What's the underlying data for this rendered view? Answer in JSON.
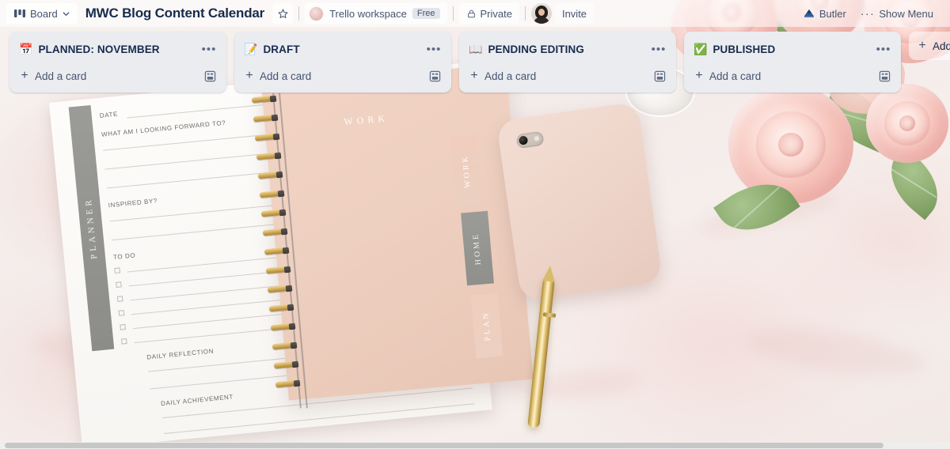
{
  "header": {
    "board_button_label": "Board",
    "board_button_icon": "board-columns-icon",
    "board_button_chevron": "chevron-down-icon",
    "title": "MWC Blog Content Calendar",
    "star_icon": "star-icon",
    "workspace": {
      "name": "Trello workspace",
      "plan_badge": "Free",
      "avatar_icon": "workspace-avatar-icon"
    },
    "visibility": {
      "label": "Private",
      "icon": "lock-icon"
    },
    "member_avatar_icon": "member-avatar",
    "invite_label": "Invite",
    "butler": {
      "label": "Butler",
      "icon": "butler-icon"
    },
    "show_menu": {
      "label": "Show Menu",
      "icon": "ellipsis-icon"
    }
  },
  "lists": [
    {
      "emoji": "📅",
      "emoji_name": "calendar-icon",
      "title": "PLANNED: NOVEMBER",
      "menu_glyph": "•••",
      "add_card_label": "Add a card",
      "add_card_plus": "+",
      "template_icon": "card-template-icon"
    },
    {
      "emoji": "📝",
      "emoji_name": "memo-icon",
      "title": "DRAFT",
      "menu_glyph": "•••",
      "add_card_label": "Add a card",
      "add_card_plus": "+",
      "template_icon": "card-template-icon"
    },
    {
      "emoji": "📖",
      "emoji_name": "open-book-icon",
      "title": "PENDING EDITING",
      "menu_glyph": "•••",
      "add_card_label": "Add a card",
      "add_card_plus": "+",
      "template_icon": "card-template-icon"
    },
    {
      "emoji": "✅",
      "emoji_name": "check-mark-icon",
      "title": "PUBLISHED",
      "menu_glyph": "•••",
      "add_card_label": "Add a card",
      "add_card_plus": "+",
      "template_icon": "card-template-icon"
    }
  ],
  "add_list": {
    "label": "Add another list",
    "plus": "+"
  },
  "background": {
    "description": "Flat-lay photo of a pink spiral planner notebook, pink phone case, gold pen and pink roses on marble",
    "planner_sidebar_text": "PLANNER",
    "notebook_cover_text": "WORK",
    "tabs": [
      "WORK",
      "HOME",
      "PLAN"
    ],
    "paper_labels": [
      "DATE",
      "WHAT AM I LOOKING FORWARD TO?",
      "INSPIRED BY?",
      "TO DO",
      "DAILY REFLECTION",
      "DAILY ACHIEVEMENT"
    ]
  },
  "colors": {
    "list_background": "#ebecf0",
    "text_primary": "#172b4d",
    "text_secondary": "#44546f",
    "header_overlay": "rgba(255,255,255,0.55)",
    "scrollbar_thumb": "#c7c7c7"
  }
}
